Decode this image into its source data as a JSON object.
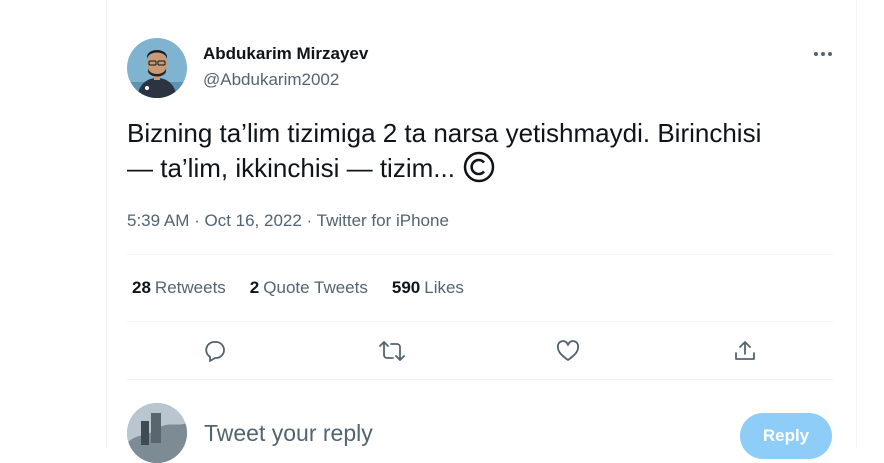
{
  "tweet": {
    "author_name": "Abdukarim Mirzayev",
    "author_handle": "@Abdukarim2002",
    "text_line1": "Bizning ta’lim tizimiga 2 ta narsa yetishmaydi. Birinchisi",
    "text_line2": "— ta’lim, ikkinchisi — tizim...",
    "emoji_icon": "copyright-icon",
    "timestamp": "5:39 AM · Oct 16, 2022 · Twitter for iPhone"
  },
  "stats": {
    "retweets_count": "28",
    "retweets_label": "Retweets",
    "quotes_count": "2",
    "quotes_label": "Quote Tweets",
    "likes_count": "590",
    "likes_label": "Likes"
  },
  "actions": [
    "reply-icon",
    "retweet-icon",
    "like-icon",
    "share-icon"
  ],
  "reply_box": {
    "placeholder": "Tweet your reply",
    "button_label": "Reply"
  },
  "colors": {
    "text": "#0f1419",
    "secondary": "#536471",
    "divider": "#eff3f4",
    "reply_button": "#8ecdf8"
  }
}
